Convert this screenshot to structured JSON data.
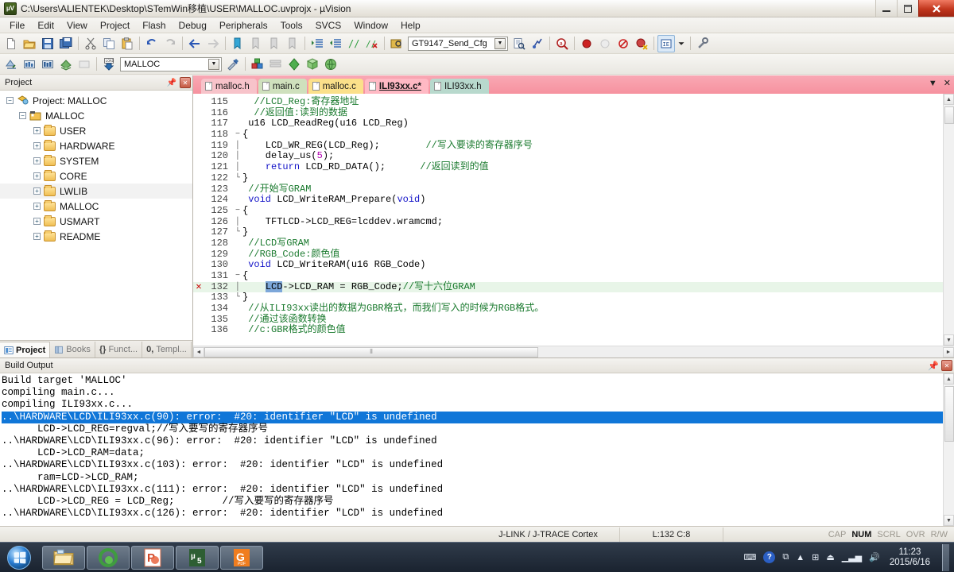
{
  "titlebar": {
    "icon": "uvision-app-icon",
    "title": "C:\\Users\\ALIENTEK\\Desktop\\STemWin移植\\USER\\MALLOC.uvprojx - µVision",
    "minimize": "—",
    "maximize": "❐",
    "close": "✕"
  },
  "menu": [
    "File",
    "Edit",
    "View",
    "Project",
    "Flash",
    "Debug",
    "Peripherals",
    "Tools",
    "SVCS",
    "Window",
    "Help"
  ],
  "toolbar1": {
    "icons": [
      "new-file-icon",
      "open-file-icon",
      "save-icon",
      "save-all-icon",
      "cut-icon",
      "copy-icon",
      "paste-icon",
      "undo-icon",
      "redo-icon",
      "navigate-back-icon",
      "navigate-forward-icon",
      "bookmark-toggle-icon",
      "bookmark-prev-icon",
      "bookmark-next-icon",
      "bookmark-clear-icon",
      "indent-icon",
      "outdent-icon",
      "comment-icon",
      "uncomment-icon",
      "find-in-files-icon",
      "find-next-icon",
      "find-icon",
      "insert-breakpoint-icon",
      "disable-breakpoint-icon",
      "kill-all-breakpoints-icon",
      "disable-all-breakpoints-icon",
      "start-debug-icon",
      "dropdown-icon",
      "configuration-wizard-icon"
    ],
    "find_value": "GT9147_Send_Cfg"
  },
  "toolbar2": {
    "icons": [
      "translate-icon",
      "build-icon",
      "rebuild-icon",
      "batch-build-icon",
      "stop-build-icon",
      "download-icon",
      "manage-project-icon",
      "project-items-icon",
      "books-icon",
      "target-options-icon",
      "manage-runtime-icon",
      "multi-project-icon"
    ],
    "target_value": "MALLOC",
    "load_label": "LOAD"
  },
  "project_panel": {
    "header": "Project",
    "pin_icon": "pin-icon",
    "close_icon": "close-icon",
    "tree": [
      {
        "label": "Project: MALLOC",
        "level": 0,
        "expander": "−",
        "icon": "project-icon",
        "selected": false
      },
      {
        "label": "MALLOC",
        "level": 1,
        "expander": "−",
        "icon": "target-icon",
        "selected": false
      },
      {
        "label": "USER",
        "level": 2,
        "expander": "+",
        "icon": "folder-icon",
        "selected": false
      },
      {
        "label": "HARDWARE",
        "level": 2,
        "expander": "+",
        "icon": "folder-icon",
        "selected": false
      },
      {
        "label": "SYSTEM",
        "level": 2,
        "expander": "+",
        "icon": "folder-icon",
        "selected": false
      },
      {
        "label": "CORE",
        "level": 2,
        "expander": "+",
        "icon": "folder-icon",
        "selected": false
      },
      {
        "label": "LWLIB",
        "level": 2,
        "expander": "+",
        "icon": "folder-icon",
        "selected": true
      },
      {
        "label": "MALLOC",
        "level": 2,
        "expander": "+",
        "icon": "folder-icon",
        "selected": false
      },
      {
        "label": "USMART",
        "level": 2,
        "expander": "+",
        "icon": "folder-icon",
        "selected": false
      },
      {
        "label": "README",
        "level": 2,
        "expander": "+",
        "icon": "folder-icon",
        "selected": false
      }
    ],
    "bottom_tabs": [
      {
        "label": "Project",
        "icon": "project-tab-icon",
        "active": true
      },
      {
        "label": "Books",
        "icon": "books-tab-icon",
        "active": false
      },
      {
        "label": "Funct...",
        "icon": "functions-tab-icon",
        "active": false
      },
      {
        "label": "Templ...",
        "icon": "templates-tab-icon",
        "active": false
      }
    ]
  },
  "editor": {
    "tabs": [
      {
        "label": "malloc.h",
        "active": false,
        "modified": false,
        "color": "#f7c3ca"
      },
      {
        "label": "main.c",
        "active": false,
        "modified": false,
        "color": "#cfe0bd"
      },
      {
        "label": "malloc.c",
        "active": false,
        "modified": false,
        "color": "#fbe08a"
      },
      {
        "label": "ILI93xx.c*",
        "active": true,
        "modified": true,
        "color": "#ffb9c4"
      },
      {
        "label": "ILI93xx.h",
        "active": false,
        "modified": false,
        "color": "#b8d9cd"
      }
    ],
    "tab_dropdown_icon": "chevron-down-icon",
    "tab_close_icon": "close-icon",
    "lines": [
      {
        "num": "115",
        "fold": "",
        "marker": "",
        "segs": [
          {
            "t": "  //LCD_Reg:寄存器地址",
            "c": "cm"
          }
        ]
      },
      {
        "num": "116",
        "fold": "",
        "marker": "",
        "segs": [
          {
            "t": "  //返回值:读到的数据",
            "c": "cm"
          }
        ]
      },
      {
        "num": "117",
        "fold": "",
        "marker": "",
        "segs": [
          {
            "t": " u16 LCD_ReadReg(u16 LCD_Reg)",
            "c": ""
          }
        ]
      },
      {
        "num": "118",
        "fold": "−",
        "marker": "",
        "segs": [
          {
            "t": "{",
            "c": ""
          }
        ]
      },
      {
        "num": "119",
        "fold": "│",
        "marker": "",
        "segs": [
          {
            "t": "    LCD_WR_REG(LCD_Reg);        ",
            "c": ""
          },
          {
            "t": "//写入要读的寄存器序号",
            "c": "cm"
          }
        ]
      },
      {
        "num": "120",
        "fold": "│",
        "marker": "",
        "segs": [
          {
            "t": "    delay_us(",
            "c": ""
          },
          {
            "t": "5",
            "c": "num-lit"
          },
          {
            "t": ");",
            "c": ""
          }
        ]
      },
      {
        "num": "121",
        "fold": "│",
        "marker": "",
        "segs": [
          {
            "t": "    ",
            "c": ""
          },
          {
            "t": "return",
            "c": "kw"
          },
          {
            "t": " LCD_RD_DATA();      ",
            "c": ""
          },
          {
            "t": "//返回读到的值",
            "c": "cm"
          }
        ]
      },
      {
        "num": "122",
        "fold": "└",
        "marker": "",
        "segs": [
          {
            "t": "}",
            "c": ""
          }
        ]
      },
      {
        "num": "123",
        "fold": "",
        "marker": "",
        "segs": [
          {
            "t": " //开始写GRAM",
            "c": "cm"
          }
        ]
      },
      {
        "num": "124",
        "fold": "",
        "marker": "",
        "segs": [
          {
            "t": " ",
            "c": ""
          },
          {
            "t": "void",
            "c": "kw"
          },
          {
            "t": " LCD_WriteRAM_Prepare(",
            "c": ""
          },
          {
            "t": "void",
            "c": "kw"
          },
          {
            "t": ")",
            "c": ""
          }
        ]
      },
      {
        "num": "125",
        "fold": "−",
        "marker": "",
        "segs": [
          {
            "t": "{",
            "c": ""
          }
        ]
      },
      {
        "num": "126",
        "fold": "│",
        "marker": "",
        "segs": [
          {
            "t": "    TFTLCD->LCD_REG=lcddev.wramcmd;",
            "c": ""
          }
        ]
      },
      {
        "num": "127",
        "fold": "└",
        "marker": "",
        "segs": [
          {
            "t": "}",
            "c": ""
          }
        ]
      },
      {
        "num": "128",
        "fold": "",
        "marker": "",
        "segs": [
          {
            "t": " //LCD写GRAM",
            "c": "cm"
          }
        ]
      },
      {
        "num": "129",
        "fold": "",
        "marker": "",
        "segs": [
          {
            "t": " //RGB_Code:颜色值",
            "c": "cm"
          }
        ]
      },
      {
        "num": "130",
        "fold": "",
        "marker": "",
        "segs": [
          {
            "t": " ",
            "c": ""
          },
          {
            "t": "void",
            "c": "kw"
          },
          {
            "t": " LCD_WriteRAM(u16 RGB_Code)",
            "c": ""
          }
        ]
      },
      {
        "num": "131",
        "fold": "−",
        "marker": "",
        "segs": [
          {
            "t": "{",
            "c": ""
          }
        ]
      },
      {
        "num": "132",
        "fold": "│",
        "marker": "✕",
        "highlight": true,
        "segs": [
          {
            "t": "    ",
            "c": ""
          },
          {
            "t": "LCD",
            "c": "selword"
          },
          {
            "t": "->LCD_RAM = RGB_Code;",
            "c": ""
          },
          {
            "t": "//写十六位GRAM",
            "c": "cm"
          }
        ]
      },
      {
        "num": "133",
        "fold": "└",
        "marker": "",
        "segs": [
          {
            "t": "}",
            "c": ""
          }
        ]
      },
      {
        "num": "134",
        "fold": "",
        "marker": "",
        "segs": [
          {
            "t": " //从ILI93xx读出的数据为GBR格式，而我们写入的时候为RGB格式。",
            "c": "cm"
          }
        ]
      },
      {
        "num": "135",
        "fold": "",
        "marker": "",
        "segs": [
          {
            "t": " //通过该函数转换",
            "c": "cm"
          }
        ]
      },
      {
        "num": "136",
        "fold": "",
        "marker": "",
        "segs": [
          {
            "t": " //c:GBR格式的颜色值",
            "c": "cm"
          }
        ]
      }
    ]
  },
  "build_output": {
    "header": "Build Output",
    "pin_icon": "pin-icon",
    "close_icon": "close-icon",
    "lines": [
      {
        "text": "Build target 'MALLOC'",
        "selected": false
      },
      {
        "text": "compiling main.c...",
        "selected": false
      },
      {
        "text": "compiling ILI93xx.c...",
        "selected": false
      },
      {
        "text": "..\\HARDWARE\\LCD\\ILI93xx.c(90): error:  #20: identifier \"LCD\" is undefined",
        "selected": true
      },
      {
        "text": "      LCD->LCD_REG=regval;//写入要写的寄存器序号",
        "selected": false
      },
      {
        "text": "..\\HARDWARE\\LCD\\ILI93xx.c(96): error:  #20: identifier \"LCD\" is undefined",
        "selected": false
      },
      {
        "text": "      LCD->LCD_RAM=data;",
        "selected": false
      },
      {
        "text": "..\\HARDWARE\\LCD\\ILI93xx.c(103): error:  #20: identifier \"LCD\" is undefined",
        "selected": false
      },
      {
        "text": "      ram=LCD->LCD_RAM;",
        "selected": false
      },
      {
        "text": "..\\HARDWARE\\LCD\\ILI93xx.c(111): error:  #20: identifier \"LCD\" is undefined",
        "selected": false
      },
      {
        "text": "      LCD->LCD_REG = LCD_Reg;        //写入要写的寄存器序号",
        "selected": false
      },
      {
        "text": "..\\HARDWARE\\LCD\\ILI93xx.c(126): error:  #20: identifier \"LCD\" is undefined",
        "selected": false
      }
    ]
  },
  "statusbar": {
    "debugger": "J-LINK / J-TRACE Cortex",
    "position": "L:132 C:8",
    "flags": [
      {
        "label": "CAP",
        "on": false
      },
      {
        "label": "NUM",
        "on": true
      },
      {
        "label": "SCRL",
        "on": false
      },
      {
        "label": "OVR",
        "on": false
      },
      {
        "label": "R/W",
        "on": false
      }
    ]
  },
  "taskbar": {
    "start_icon": "windows-start-icon",
    "tasks": [
      {
        "icon": "file-explorer-icon",
        "label": ""
      },
      {
        "icon": "green-browser-icon",
        "label": ""
      },
      {
        "icon": "powerpoint-icon",
        "label": ""
      },
      {
        "icon": "uvision-taskbar-icon",
        "label": ""
      },
      {
        "icon": "pdf-reader-icon",
        "label": ""
      }
    ],
    "tray": [
      "keyboard-icon",
      "help-icon",
      "network-flyout-icon",
      "show-hidden-icon",
      "windows-icon",
      "usb-eject-icon",
      "signal-icon",
      "volume-icon"
    ],
    "time": "11:23",
    "date": "2015/6/16"
  },
  "colors": {
    "accent_pink": "#f6929f",
    "selection_blue": "#1076d8",
    "comment_green": "#1a7a2e",
    "keyword_blue": "#1414c8",
    "error_red": "#cc0000"
  }
}
